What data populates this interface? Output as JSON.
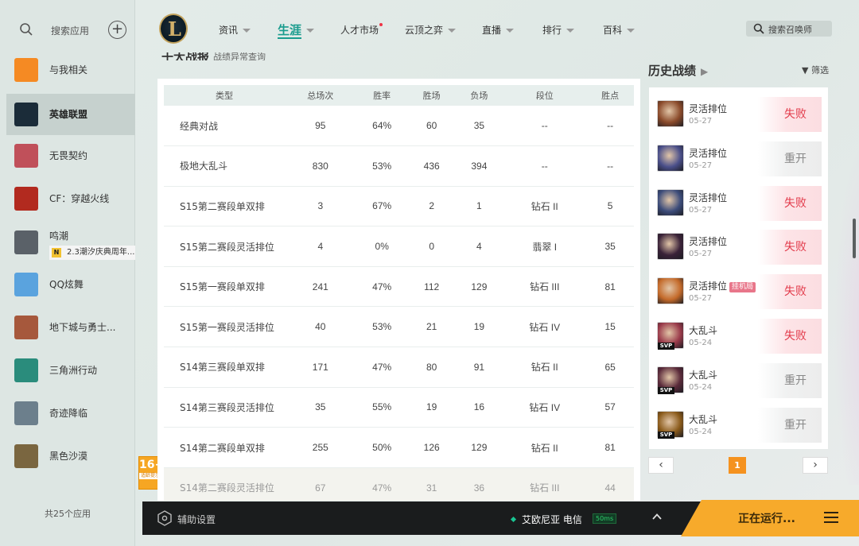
{
  "sidebar": {
    "search_placeholder": "搜索应用",
    "add_icon": "plus-circle-icon",
    "items": [
      {
        "label": "与我相关",
        "icon": "related-icon",
        "color": "#f58a23"
      },
      {
        "label": "英雄联盟",
        "icon": "lol-icon",
        "color": "#1b2c39",
        "active": true
      },
      {
        "label": "无畏契约",
        "icon": "valorant-icon",
        "color": "#c0505a"
      },
      {
        "label": "CF：穿越火线",
        "icon": "crossfire-icon",
        "color": "#b22a1f"
      },
      {
        "label": "鸣潮",
        "icon": "wuthering-icon",
        "color": "#5a6168",
        "sub": "2.3潮汐庆典周年..."
      },
      {
        "label": "QQ炫舞",
        "icon": "qqdance-icon",
        "color": "#5aa3de"
      },
      {
        "label": "地下城与勇士...",
        "icon": "dnf-icon",
        "color": "#a6583c"
      },
      {
        "label": "三角洲行动",
        "icon": "delta-icon",
        "color": "#2a8c7c"
      },
      {
        "label": "奇迹降临",
        "icon": "miracle-icon",
        "color": "#6c7f8c"
      },
      {
        "label": "黑色沙漠",
        "icon": "blackdesert-icon",
        "color": "#7a6640"
      }
    ],
    "footer": "共25个应用",
    "age_badge": {
      "big": "16+",
      "small": "适龄提示"
    }
  },
  "nav": {
    "logo_letter": "L",
    "items": [
      {
        "label": "资讯",
        "caret": true
      },
      {
        "label": "生涯",
        "caret": true,
        "active": true
      },
      {
        "label": "人才市场",
        "dot": true
      },
      {
        "label": "云顶之弈",
        "caret": true
      },
      {
        "label": "直播",
        "caret": true
      },
      {
        "label": "排行",
        "caret": true
      },
      {
        "label": "百科",
        "caret": true
      }
    ],
    "summoner_search_placeholder": "搜索召唤师"
  },
  "main": {
    "section_title": "十大战报",
    "section_subtitle": "战绩异常查询",
    "columns": [
      "类型",
      "总场次",
      "胜率",
      "胜场",
      "负场",
      "段位",
      "胜点"
    ],
    "rows": [
      [
        "经典对战",
        "95",
        "64%",
        "60",
        "35",
        "--",
        "--"
      ],
      [
        "极地大乱斗",
        "830",
        "53%",
        "436",
        "394",
        "--",
        "--"
      ],
      [
        "S15第二赛段单双排",
        "3",
        "67%",
        "2",
        "1",
        "钻石 II",
        "5"
      ],
      [
        "S15第二赛段灵活排位",
        "4",
        "0%",
        "0",
        "4",
        "翡翠 I",
        "35"
      ],
      [
        "S15第一赛段单双排",
        "241",
        "47%",
        "112",
        "129",
        "钻石 III",
        "81"
      ],
      [
        "S15第一赛段灵活排位",
        "40",
        "53%",
        "21",
        "19",
        "钻石 IV",
        "15"
      ],
      [
        "S14第三赛段单双排",
        "171",
        "47%",
        "80",
        "91",
        "钻石 II",
        "65"
      ],
      [
        "S14第三赛段灵活排位",
        "35",
        "55%",
        "19",
        "16",
        "钻石 IV",
        "57"
      ],
      [
        "S14第二赛段单双排",
        "255",
        "50%",
        "126",
        "129",
        "钻石 II",
        "81"
      ],
      [
        "S14第二赛段灵活排位",
        "67",
        "47%",
        "31",
        "36",
        "钻石 III",
        "44"
      ]
    ]
  },
  "history": {
    "title": "历史战绩",
    "filter_label": "筛选",
    "matches": [
      {
        "mode": "灵活排位",
        "date": "05-27",
        "result": "失败",
        "outcome": "lose",
        "champ_color": "#8a4a2a"
      },
      {
        "mode": "灵活排位",
        "date": "05-27",
        "result": "重开",
        "outcome": "redo",
        "champ_color": "#4a4f8a"
      },
      {
        "mode": "灵活排位",
        "date": "05-27",
        "result": "失败",
        "outcome": "lose",
        "champ_color": "#3c4c7a"
      },
      {
        "mode": "灵活排位",
        "date": "05-27",
        "result": "失败",
        "outcome": "lose",
        "champ_color": "#3a2238"
      },
      {
        "mode": "灵活排位",
        "tag": "挂机局",
        "date": "05-27",
        "result": "失败",
        "outcome": "lose",
        "champ_color": "#c46a2a"
      },
      {
        "mode": "大乱斗",
        "date": "05-24",
        "result": "失败",
        "outcome": "lose",
        "champ_color": "#9a3a4a",
        "svp": "SVP"
      },
      {
        "mode": "大乱斗",
        "date": "05-24",
        "result": "重开",
        "outcome": "redo",
        "champ_color": "#5a2a3a",
        "svp": "SVP"
      },
      {
        "mode": "大乱斗",
        "date": "05-24",
        "result": "重开",
        "outcome": "redo",
        "champ_color": "#8a5a1a",
        "svp": "SVP"
      }
    ],
    "pager": {
      "prev": "‹",
      "page": "1",
      "next": "›"
    }
  },
  "bottom": {
    "assist_label": "辅助设置",
    "server": "艾欧尼亚 电信",
    "ping": "50ms",
    "running_label": "正在运行..."
  }
}
